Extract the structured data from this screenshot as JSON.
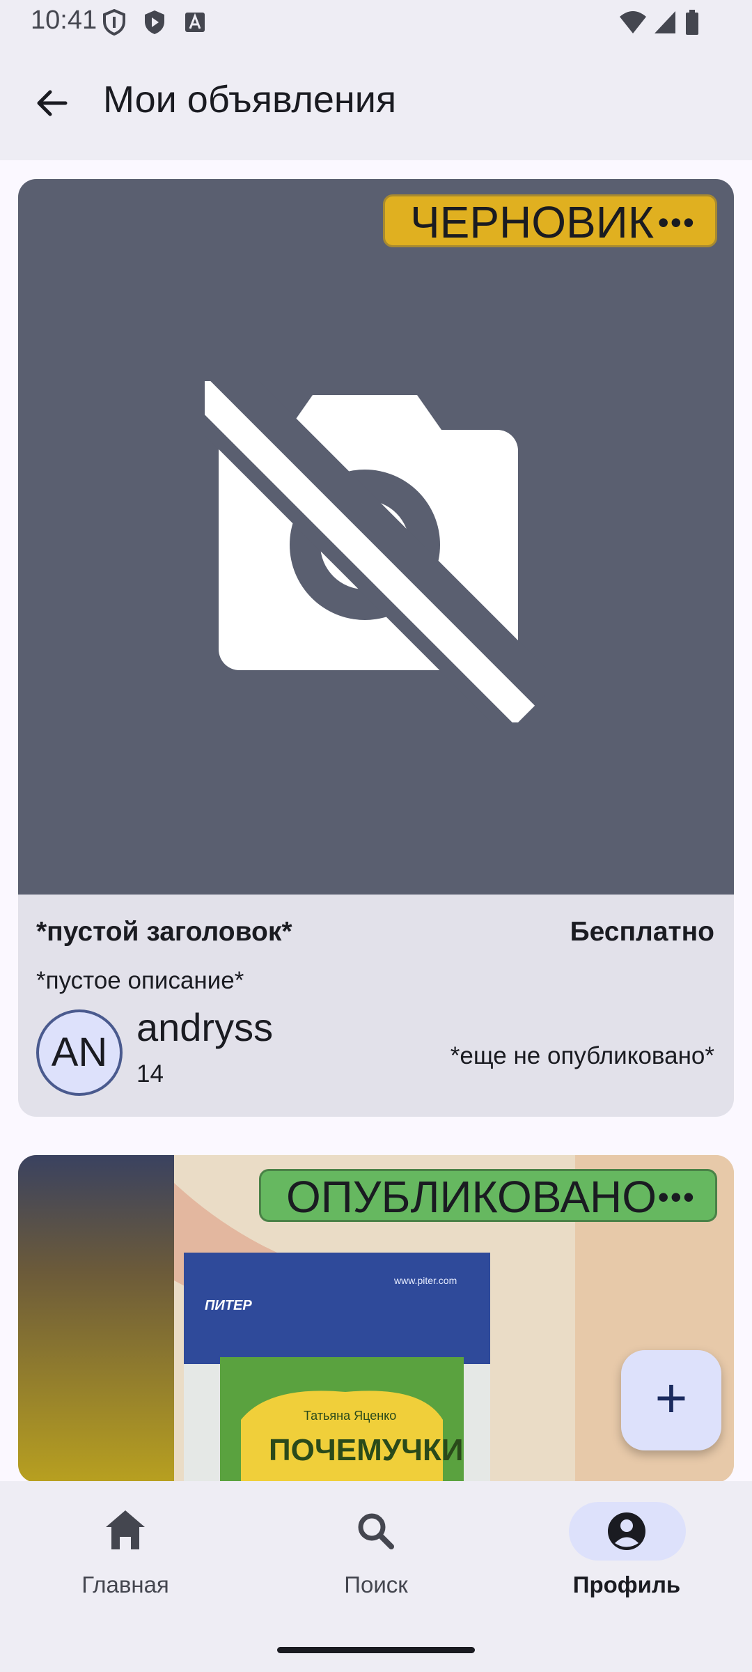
{
  "status_bar": {
    "time": "10:41"
  },
  "app_bar": {
    "title": "Мои объявления"
  },
  "listings": [
    {
      "status": "ЧЕРНОВИК",
      "status_color": "#e0b020",
      "title": "*пустой заголовок*",
      "price": "Бесплатно",
      "description": "*пустое описание*",
      "avatar_initials": "AN",
      "username": "andryss",
      "user_count": "14",
      "publish_state": "*еще не опубликовано*"
    },
    {
      "status": "ОПУБЛИКОВАНО",
      "status_color": "#66b860"
    }
  ],
  "fab": {
    "label": "+"
  },
  "bottom_nav": {
    "items": [
      {
        "label": "Главная",
        "icon": "home-icon"
      },
      {
        "label": "Поиск",
        "icon": "search-icon"
      },
      {
        "label": "Профиль",
        "icon": "account-circle-icon",
        "active": true
      }
    ]
  },
  "colors": {
    "accent": "#dde1fb",
    "surface": "#eeedf4",
    "image_placeholder": "#5a5f70"
  }
}
